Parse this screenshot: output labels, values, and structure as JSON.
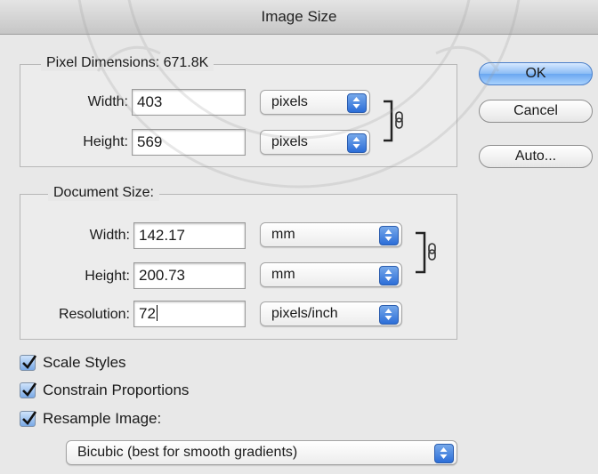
{
  "window": {
    "title": "Image Size"
  },
  "pixel_dimensions": {
    "legend": "Pixel Dimensions:  671.8K",
    "width_label": "Width:",
    "width_value": "403",
    "width_unit": "pixels",
    "height_label": "Height:",
    "height_value": "569",
    "height_unit": "pixels"
  },
  "document_size": {
    "legend": "Document Size:",
    "width_label": "Width:",
    "width_value": "142.17",
    "width_unit": "mm",
    "height_label": "Height:",
    "height_value": "200.73",
    "height_unit": "mm",
    "resolution_label": "Resolution:",
    "resolution_value": "72",
    "resolution_unit": "pixels/inch"
  },
  "buttons": {
    "ok": "OK",
    "cancel": "Cancel",
    "auto": "Auto..."
  },
  "options": {
    "scale_styles": "Scale Styles",
    "constrain_proportions": "Constrain Proportions",
    "resample_image": "Resample Image:",
    "scale_styles_checked": true,
    "constrain_checked": true,
    "resample_checked": true,
    "resample_method": "Bicubic (best for smooth gradients)"
  },
  "icons": {
    "chain": "chain-link-icon",
    "select_arrows": "up-down-arrows-icon",
    "checkmark": "checkmark-icon"
  },
  "colors": {
    "accent": "#3b7de0",
    "background": "#e8e8e8"
  }
}
